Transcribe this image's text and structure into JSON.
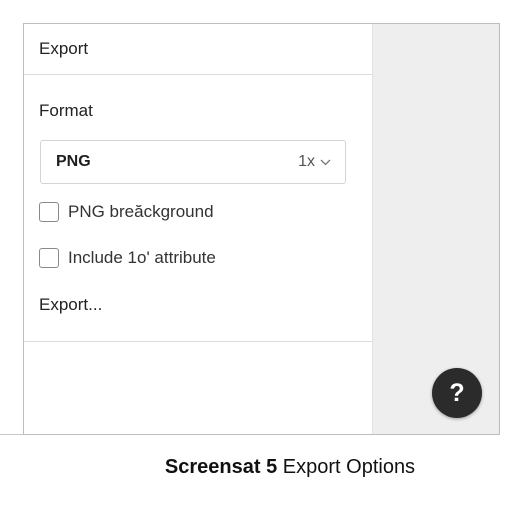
{
  "panel": {
    "title": "Export",
    "format_label": "Format",
    "format_select": {
      "value": "PNG",
      "scale": "1x"
    },
    "checkboxes": [
      {
        "label": "PNG breăckground",
        "checked": false
      },
      {
        "label": "Include 1o' attribute",
        "checked": false
      }
    ],
    "export_link": "Export..."
  },
  "help": {
    "label": "?"
  },
  "caption": {
    "bold": "Screensat 5",
    "rest": " Export Options"
  }
}
